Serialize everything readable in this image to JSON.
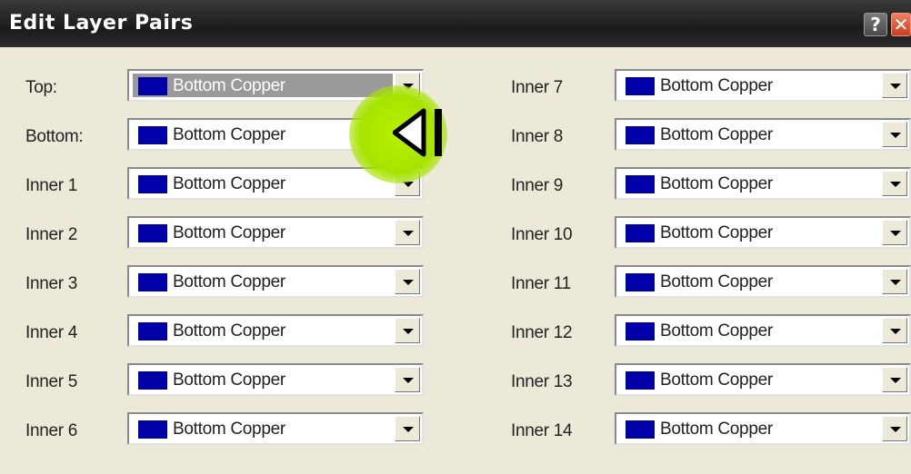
{
  "window": {
    "title": "Edit Layer Pairs",
    "help_glyph": "?",
    "close_glyph": "✕"
  },
  "combo_value": "Bottom Copper",
  "swatch_color": "#0000a8",
  "left_rows": [
    {
      "label": "Top:",
      "value": "Bottom Copper",
      "selected": true
    },
    {
      "label": "Bottom:",
      "value": "Bottom Copper"
    },
    {
      "label": "Inner 1",
      "value": "Bottom Copper"
    },
    {
      "label": "Inner 2",
      "value": "Bottom Copper"
    },
    {
      "label": "Inner 3",
      "value": "Bottom Copper"
    },
    {
      "label": "Inner 4",
      "value": "Bottom Copper"
    },
    {
      "label": "Inner 5",
      "value": "Bottom Copper"
    },
    {
      "label": "Inner 6",
      "value": "Bottom Copper"
    }
  ],
  "right_rows": [
    {
      "label": "Inner 7",
      "value": "Bottom Copper"
    },
    {
      "label": "Inner 8",
      "value": "Bottom Copper"
    },
    {
      "label": "Inner 9",
      "value": "Bottom Copper"
    },
    {
      "label": "Inner 10",
      "value": "Bottom Copper"
    },
    {
      "label": "Inner 11",
      "value": "Bottom Copper"
    },
    {
      "label": "Inner 12",
      "value": "Bottom Copper"
    },
    {
      "label": "Inner 13",
      "value": "Bottom Copper"
    },
    {
      "label": "Inner 14",
      "value": "Bottom Copper"
    }
  ]
}
